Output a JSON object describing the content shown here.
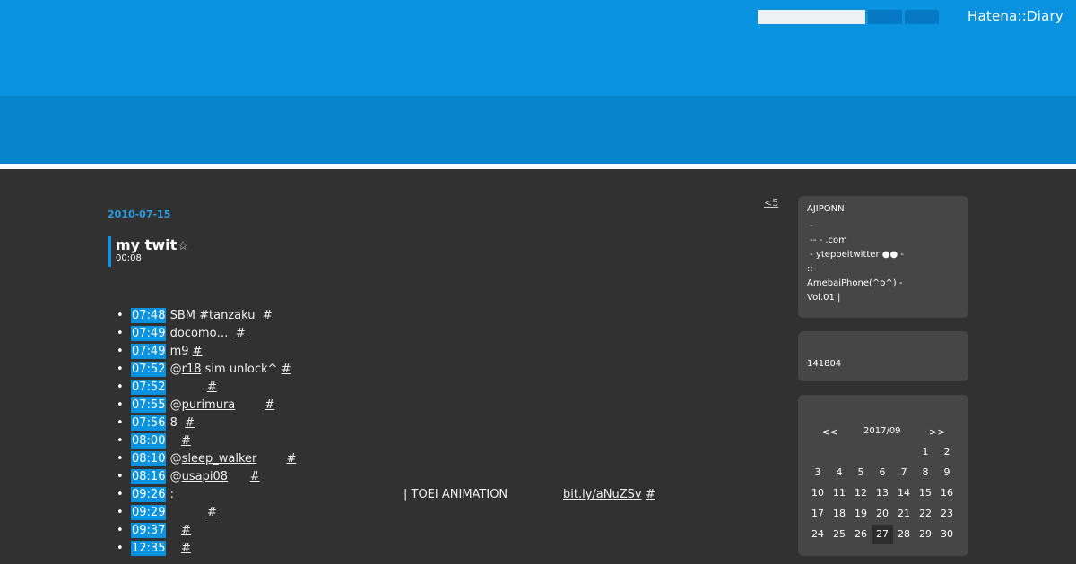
{
  "header": {
    "search_placeholder": "",
    "search_button_1": "",
    "search_button_2": "",
    "logo": "Hatena::Diary"
  },
  "main": {
    "older_link": "<5",
    "date": "2010-07-15",
    "title": "my twit",
    "title_icon": "⚝",
    "time": "00:08",
    "tweets": [
      {
        "time": "07:48",
        "parts": [
          {
            "t": "text",
            "v": " SBM #tanzaku  "
          }
        ],
        "anchor": "#"
      },
      {
        "time": "07:49",
        "parts": [
          {
            "t": "text",
            "v": " docomo…  "
          }
        ],
        "anchor": "#"
      },
      {
        "time": "07:49",
        "parts": [
          {
            "t": "text",
            "v": " m9 "
          }
        ],
        "anchor": "#"
      },
      {
        "time": "07:52",
        "parts": [
          {
            "t": "text",
            "v": " @"
          },
          {
            "t": "user",
            "v": "r18"
          },
          {
            "t": "text",
            "v": " sim unlock^ "
          }
        ],
        "anchor": "#"
      },
      {
        "time": "07:52",
        "parts": [
          {
            "t": "text",
            "v": "           "
          }
        ],
        "anchor": "#"
      },
      {
        "time": "07:55",
        "parts": [
          {
            "t": "text",
            "v": " @"
          },
          {
            "t": "user",
            "v": "purimura"
          },
          {
            "t": "text",
            "v": "        "
          }
        ],
        "anchor": "#"
      },
      {
        "time": "07:56",
        "parts": [
          {
            "t": "text",
            "v": " 8  "
          }
        ],
        "anchor": "#"
      },
      {
        "time": "08:00",
        "parts": [
          {
            "t": "text",
            "v": "    "
          }
        ],
        "anchor": "#"
      },
      {
        "time": "08:10",
        "parts": [
          {
            "t": "text",
            "v": " @"
          },
          {
            "t": "user",
            "v": "sleep_walker"
          },
          {
            "t": "text",
            "v": "        "
          }
        ],
        "anchor": "#"
      },
      {
        "time": "08:16",
        "parts": [
          {
            "t": "text",
            "v": " @"
          },
          {
            "t": "user",
            "v": "usapi08"
          },
          {
            "t": "text",
            "v": "      "
          }
        ],
        "anchor": "#"
      },
      {
        "time": "09:26",
        "parts": [
          {
            "t": "text",
            "v": " :"
          }
        ],
        "extra": "| TOEI ANIMATION",
        "link": "bit.ly/aNuZSv",
        "anchor": "#"
      },
      {
        "time": "09:29",
        "parts": [
          {
            "t": "text",
            "v": "           "
          }
        ],
        "anchor": "#"
      },
      {
        "time": "09:37",
        "parts": [
          {
            "t": "text",
            "v": "    "
          }
        ],
        "anchor": "#"
      },
      {
        "time": "12:35",
        "parts": [
          {
            "t": "text",
            "v": "    "
          }
        ],
        "anchor": "#"
      }
    ]
  },
  "sidebar": {
    "profile": {
      "name": "AJIPONN",
      "lines": [
        " -",
        " -- - .com",
        " - yteppeitwitter ●● -",
        "::",
        "AmebaiPhone(^o^) -",
        "Vol.01 |"
      ]
    },
    "counter": "141804",
    "calendar": {
      "prev": "<<",
      "month": "2017/09",
      "next": ">>",
      "today": "27",
      "weeks": [
        [
          "",
          "",
          "",
          "",
          "",
          "1",
          "2"
        ],
        [
          "3",
          "4",
          "5",
          "6",
          "7",
          "8",
          "9"
        ],
        [
          "10",
          "11",
          "12",
          "13",
          "14",
          "15",
          "16"
        ],
        [
          "17",
          "18",
          "19",
          "20",
          "21",
          "22",
          "23"
        ],
        [
          "24",
          "25",
          "26",
          "27",
          "28",
          "29",
          "30"
        ]
      ]
    }
  }
}
